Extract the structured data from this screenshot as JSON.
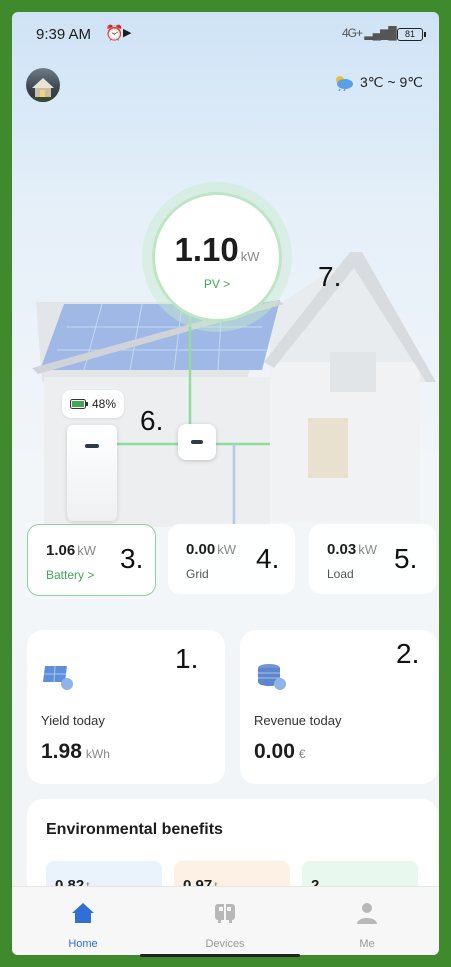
{
  "status_bar": {
    "time": "9:39 AM",
    "network": "4G+",
    "battery": "81"
  },
  "weather": {
    "range": "3℃ ~ 9℃"
  },
  "pv": {
    "value": "1.10",
    "unit": "kW",
    "link": "PV >"
  },
  "battery_pill": {
    "percent": "48%"
  },
  "annotations": {
    "a1": "1.",
    "a2": "2.",
    "a3": "3.",
    "a4": "4.",
    "a5": "5.",
    "a6": "6.",
    "a7": "7."
  },
  "flow_cards": [
    {
      "value": "1.06",
      "unit": "kW",
      "label": "Battery >"
    },
    {
      "value": "0.00",
      "unit": "kW",
      "label": "Grid"
    },
    {
      "value": "0.03",
      "unit": "kW",
      "label": "Load"
    }
  ],
  "stats": {
    "yield": {
      "label": "Yield today",
      "value": "1.98",
      "unit": "kWh"
    },
    "revenue": {
      "label": "Revenue today",
      "value": "0.00",
      "unit": "€"
    }
  },
  "environment": {
    "title": "Environmental benefits",
    "tiles": [
      {
        "value": "0.82",
        "unit": "t"
      },
      {
        "value": "0.97",
        "unit": "t"
      },
      {
        "value": "2",
        "unit": ""
      }
    ]
  },
  "tabs": [
    {
      "label": "Home"
    },
    {
      "label": "Devices"
    },
    {
      "label": "Me"
    }
  ],
  "colors": {
    "accent_green": "#3daa53",
    "active_tab": "#2f6fd6"
  }
}
